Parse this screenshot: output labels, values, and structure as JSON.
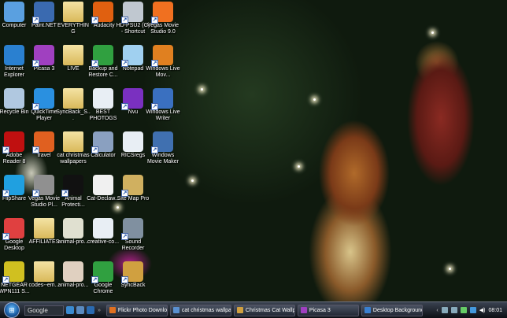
{
  "desktop": {
    "icons": [
      {
        "label": "Computer",
        "glyph": "computer-icon",
        "color": "#5aa0e0",
        "shortcut": false
      },
      {
        "label": "Paint.NET",
        "glyph": "paintnet-icon",
        "color": "#3a6ab0",
        "shortcut": true
      },
      {
        "label": "EVERYTHING",
        "glyph": "folder-icon",
        "color": "folder",
        "shortcut": false
      },
      {
        "label": "\"Audacity",
        "glyph": "audacity-icon",
        "color": "#e06010",
        "shortcut": true
      },
      {
        "label": "HD-PSU2 (G) - Shortcut",
        "glyph": "drive-icon",
        "color": "#c0c8d0",
        "shortcut": true
      },
      {
        "label": "Vegas Movie Studio 9.0",
        "glyph": "vegas-icon",
        "color": "#f07020",
        "shortcut": true
      },
      {
        "label": "Internet Explorer",
        "glyph": "ie-icon",
        "color": "#2a80d0",
        "shortcut": false
      },
      {
        "label": "Picasa 3",
        "glyph": "picasa-icon",
        "color": "#a040c0",
        "shortcut": true
      },
      {
        "label": "LIVE",
        "glyph": "folder-icon",
        "color": "folder",
        "shortcut": false
      },
      {
        "label": "Backup and Restore C...",
        "glyph": "backup-icon",
        "color": "#30a040",
        "shortcut": true
      },
      {
        "label": "Notepad",
        "glyph": "notepad-icon",
        "color": "#a0d0f0",
        "shortcut": true
      },
      {
        "label": "Windows Live Mov...",
        "glyph": "moviemaker-icon",
        "color": "#e08020",
        "shortcut": true
      },
      {
        "label": "Recycle Bin",
        "glyph": "recycle-bin-icon",
        "color": "#b0c8e0",
        "shortcut": false
      },
      {
        "label": "QuickTime Player",
        "glyph": "quicktime-icon",
        "color": "#2a90e0",
        "shortcut": true
      },
      {
        "label": "SyncBack_S...",
        "glyph": "folder-icon",
        "color": "folder",
        "shortcut": false
      },
      {
        "label": "BEST PHOTOGS",
        "glyph": "document-icon",
        "color": "#e8eef4",
        "shortcut": false
      },
      {
        "label": "Nvu",
        "glyph": "nvu-icon",
        "color": "#7a30c0",
        "shortcut": true
      },
      {
        "label": "Windows Live Writer",
        "glyph": "writer-icon",
        "color": "#3a70c0",
        "shortcut": true
      },
      {
        "label": "Adobe Reader 8",
        "glyph": "adobe-reader-icon",
        "color": "#c01010",
        "shortcut": true
      },
      {
        "label": "travel",
        "glyph": "firefox-icon",
        "color": "#e06020",
        "shortcut": true
      },
      {
        "label": "cat christmas wallpapers",
        "glyph": "folder-icon",
        "color": "folder",
        "shortcut": false
      },
      {
        "label": "Calculator",
        "glyph": "calculator-icon",
        "color": "#8aa0c0",
        "shortcut": true
      },
      {
        "label": "RICSregs",
        "glyph": "document-icon",
        "color": "#e8eef4",
        "shortcut": false
      },
      {
        "label": "Windows Movie Maker",
        "glyph": "moviemaker-icon",
        "color": "#4070b0",
        "shortcut": true
      },
      {
        "label": "FlipShare",
        "glyph": "flipshare-icon",
        "color": "#20a0e0",
        "shortcut": true
      },
      {
        "label": "Vegas Movie Studio Pl...",
        "glyph": "vegas-icon",
        "color": "#909090",
        "shortcut": true
      },
      {
        "label": "Animal Protecti...",
        "glyph": "cat-icon",
        "color": "#111111",
        "shortcut": true
      },
      {
        "label": "Cat-Declaw...",
        "glyph": "pdf-icon",
        "color": "#f0f0f0",
        "shortcut": false
      },
      {
        "label": "Site Map Pro",
        "glyph": "sitemap-icon",
        "color": "#d0b060",
        "shortcut": true
      },
      {
        "label": "",
        "glyph": "",
        "color": "",
        "shortcut": false
      },
      {
        "label": "Google Desktop",
        "glyph": "google-desktop-icon",
        "color": "#e04040",
        "shortcut": true
      },
      {
        "label": "AFFILIATES",
        "glyph": "folder-icon",
        "color": "folder",
        "shortcut": false
      },
      {
        "label": "animal-pro...",
        "glyph": "pdf-icon",
        "color": "#e0e0d0",
        "shortcut": false
      },
      {
        "label": "creative-co...",
        "glyph": "document-icon",
        "color": "#e8eef4",
        "shortcut": false
      },
      {
        "label": "Sound Recorder",
        "glyph": "microphone-icon",
        "color": "#8090a0",
        "shortcut": true
      },
      {
        "label": "",
        "glyph": "",
        "color": "",
        "shortcut": false
      },
      {
        "label": "NETGEAR WPN111 S...",
        "glyph": "netgear-icon",
        "color": "#d0c020",
        "shortcut": true
      },
      {
        "label": "codes--em...",
        "glyph": "folder-icon",
        "color": "folder",
        "shortcut": false
      },
      {
        "label": "animal-pro...",
        "glyph": "pdf-icon",
        "color": "#e0d0c0",
        "shortcut": false
      },
      {
        "label": "Google Chrome",
        "glyph": "chrome-icon",
        "color": "#30a040",
        "shortcut": true
      },
      {
        "label": "SyncBack",
        "glyph": "syncback-icon",
        "color": "#d0a040",
        "shortcut": true
      }
    ]
  },
  "taskbar": {
    "search": "Google",
    "tasks": [
      {
        "label": "Flickr Photo Downlo...",
        "color": "#e07020"
      },
      {
        "label": "cat christmas wallpa...",
        "color": "#5a90d0"
      },
      {
        "label": "Christmas Cat Wallp...",
        "color": "#d0a040"
      },
      {
        "label": "Picasa 3",
        "color": "#a040c0"
      },
      {
        "label": "Desktop Background",
        "color": "#3a80d0"
      }
    ],
    "clock": "08:01"
  }
}
